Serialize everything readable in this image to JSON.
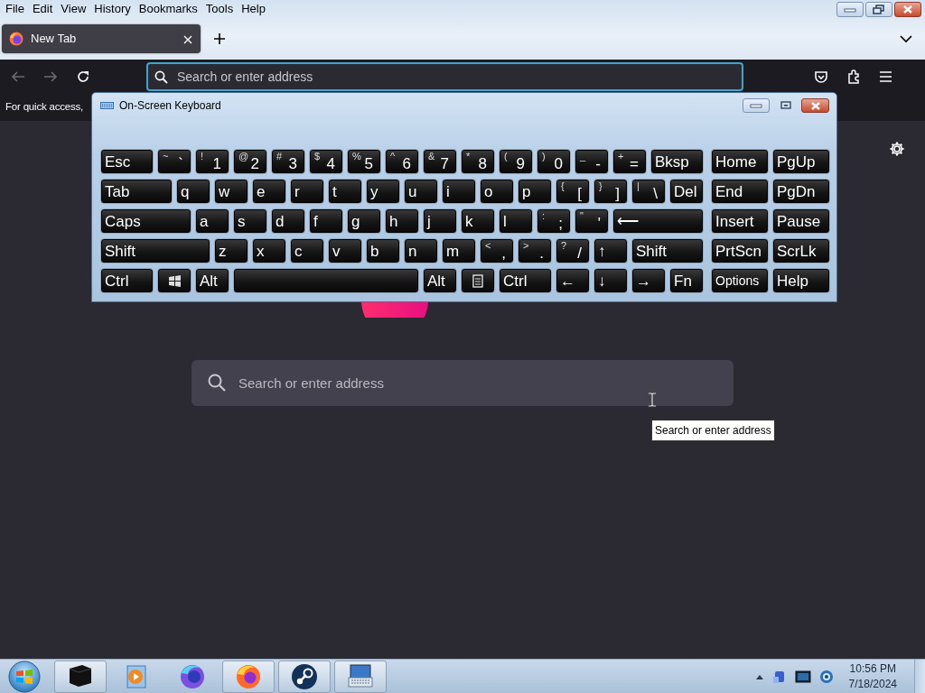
{
  "menu": [
    {
      "label": "File"
    },
    {
      "label": "Edit"
    },
    {
      "label": "View"
    },
    {
      "label": "History"
    },
    {
      "label": "Bookmarks"
    },
    {
      "label": "Tools"
    },
    {
      "label": "Help"
    }
  ],
  "tabs": [
    {
      "title": "New Tab",
      "selected": true
    }
  ],
  "address_bar": {
    "placeholder": "Search or enter address"
  },
  "bookmarks_bar": {
    "text": "For quick access,"
  },
  "keyboard_window": {
    "title": "On-Screen Keyboard",
    "rows": [
      {
        "keys": [
          {
            "label": "Esc"
          },
          {
            "label": "`",
            "shift": "~"
          },
          {
            "label": "1",
            "shift": "!"
          },
          {
            "label": "2",
            "shift": "@"
          },
          {
            "label": "3",
            "shift": "#"
          },
          {
            "label": "4",
            "shift": "$"
          },
          {
            "label": "5",
            "shift": "%"
          },
          {
            "label": "6",
            "shift": "^"
          },
          {
            "label": "7",
            "shift": "&"
          },
          {
            "label": "8",
            "shift": "*"
          },
          {
            "label": "9",
            "shift": "("
          },
          {
            "label": "0",
            "shift": ")"
          },
          {
            "label": "-",
            "shift": "_"
          },
          {
            "label": "=",
            "shift": "+"
          },
          {
            "label": "Bksp"
          },
          {
            "label": "Home"
          },
          {
            "label": "PgUp"
          }
        ]
      },
      {
        "keys": [
          {
            "label": "Tab"
          },
          {
            "label": "q"
          },
          {
            "label": "w"
          },
          {
            "label": "e"
          },
          {
            "label": "r"
          },
          {
            "label": "t"
          },
          {
            "label": "y"
          },
          {
            "label": "u"
          },
          {
            "label": "i"
          },
          {
            "label": "o"
          },
          {
            "label": "p"
          },
          {
            "label": "[",
            "shift": "{"
          },
          {
            "label": "]",
            "shift": "}"
          },
          {
            "label": "\\",
            "shift": "|"
          },
          {
            "label": "Del"
          },
          {
            "label": "End"
          },
          {
            "label": "PgDn"
          }
        ]
      },
      {
        "keys": [
          {
            "label": "Caps"
          },
          {
            "label": "a"
          },
          {
            "label": "s"
          },
          {
            "label": "d"
          },
          {
            "label": "f"
          },
          {
            "label": "g"
          },
          {
            "label": "h"
          },
          {
            "label": "j"
          },
          {
            "label": "k"
          },
          {
            "label": "l"
          },
          {
            "label": ";",
            "shift": ":"
          },
          {
            "label": "'",
            "shift": "\""
          },
          {
            "label": "⟵"
          },
          {
            "label": "Insert"
          },
          {
            "label": "Pause"
          }
        ]
      },
      {
        "keys": [
          {
            "label": "Shift"
          },
          {
            "label": "z"
          },
          {
            "label": "x"
          },
          {
            "label": "c"
          },
          {
            "label": "v"
          },
          {
            "label": "b"
          },
          {
            "label": "n"
          },
          {
            "label": "m"
          },
          {
            "label": ",",
            "shift": "<"
          },
          {
            "label": ".",
            "shift": ">"
          },
          {
            "label": "/",
            "shift": "?"
          },
          {
            "label": "↑"
          },
          {
            "label": "Shift"
          },
          {
            "label": "PrtScn"
          },
          {
            "label": "ScrLk"
          }
        ]
      },
      {
        "keys": [
          {
            "label": "Ctrl"
          },
          {
            "kind": "windows"
          },
          {
            "label": "Alt"
          },
          {
            "kind": "space"
          },
          {
            "label": "Alt"
          },
          {
            "kind": "menu"
          },
          {
            "label": "Ctrl"
          },
          {
            "label": "←"
          },
          {
            "label": "↓"
          },
          {
            "label": "→"
          },
          {
            "label": "Fn"
          },
          {
            "label": "Options",
            "kind": "small"
          },
          {
            "label": "Help"
          }
        ]
      }
    ]
  },
  "new_tab_page": {
    "search": {
      "placeholder": "Search or enter address"
    },
    "tooltip": "Search or enter address"
  },
  "taskbar": {
    "items": [
      {
        "kind": "app-box",
        "running": true
      },
      {
        "kind": "media",
        "running": false
      },
      {
        "kind": "browser-blue",
        "running": false
      },
      {
        "kind": "browser",
        "running": true
      },
      {
        "kind": "steam",
        "running": true
      },
      {
        "kind": "keyboard",
        "running": true
      }
    ],
    "clock": {
      "time": "10:56 PM",
      "date": "7/18/2024"
    }
  }
}
